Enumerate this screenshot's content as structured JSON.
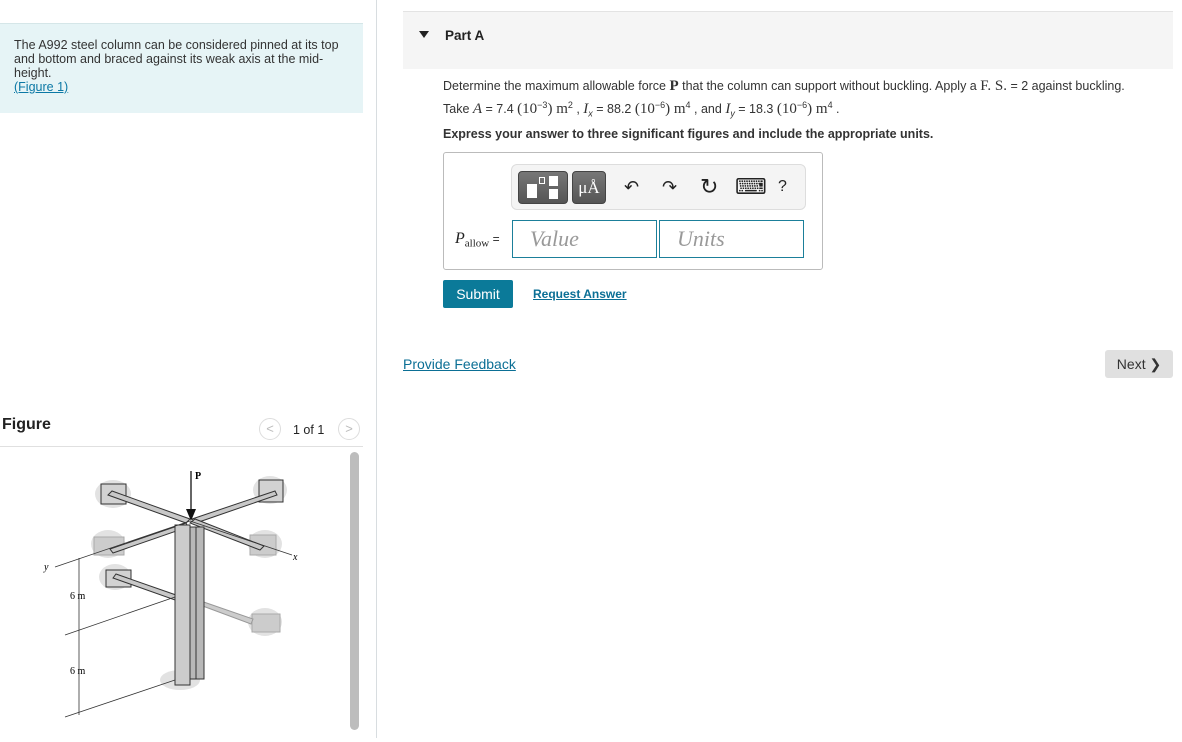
{
  "intro": {
    "text": "The A992 steel column can be considered pinned at its top and bottom and braced against its weak axis at the mid-height.",
    "figure_link": "(Figure 1)"
  },
  "figure": {
    "title": "Figure",
    "pager": "1 of 1",
    "prev": "<",
    "next": ">",
    "labels": {
      "P": "P",
      "x": "x",
      "y": "y",
      "upper": "6 m",
      "lower": "6 m"
    }
  },
  "part": {
    "label": "Part A"
  },
  "question": {
    "l1a": "Determine the maximum allowable force ",
    "l1P": "P",
    "l1b": " that the column can support without buckling. Apply a ",
    "l1FS": "F. S.",
    "l1c": " = 2 against buckling.",
    "l2a": "Take ",
    "A": "A",
    "l2b": " = 7.4 ",
    "A_exp": "(10",
    "A_pow": "−3",
    "A_close": ")",
    "m": " m",
    "pow2": "2",
    "l2c": " , ",
    "Ix": "I",
    "Ix_sub": "x",
    "l2d": " = 88.2 ",
    "Ix_exp": "(10",
    "Ix_pow": "−6",
    "Ix_close": ")",
    "m4": " m",
    "pow4": "4",
    "l2e": " , and ",
    "Iy": "I",
    "Iy_sub": "y",
    "l2f": " = 18.3 ",
    "Iy_exp": "(10",
    "Iy_pow": "−6",
    "Iy_close": ")",
    "m4b": " m",
    "pow4b": "4",
    "l2g": " .",
    "instruction": "Express your answer to three significant figures and include the appropriate units."
  },
  "answer": {
    "var": "P",
    "sub": "allow",
    "eq": " =",
    "value_placeholder": "Value",
    "units_placeholder": "Units",
    "toolbar": {
      "templates": "templates-icon",
      "units": "μÅ",
      "undo": "↶",
      "redo": "↷",
      "reset": "↻",
      "keyboard": "⌨",
      "help": "?"
    }
  },
  "actions": {
    "submit": "Submit",
    "request": "Request Answer",
    "feedback": "Provide Feedback",
    "next": "Next ❯"
  },
  "colors": {
    "accent": "#0b7a99",
    "intro_bg": "#e6f4f6"
  }
}
